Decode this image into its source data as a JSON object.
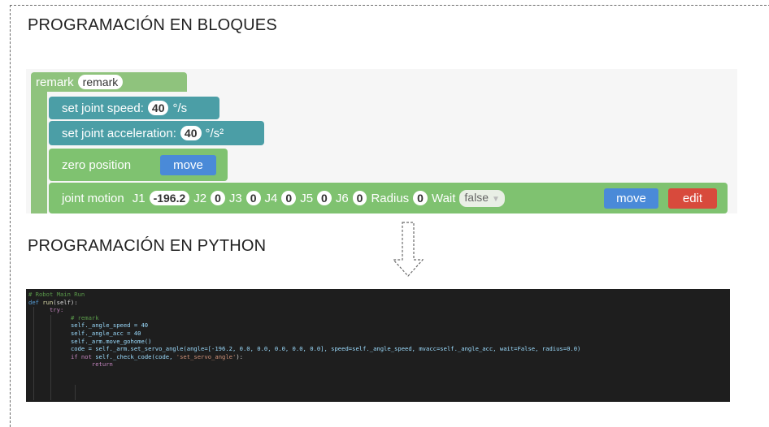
{
  "headings": {
    "blocks": "PROGRAMACIÓN EN BLOQUES",
    "python": "PROGRAMACIÓN EN PYTHON"
  },
  "blocks": {
    "remark": {
      "label": "remark",
      "value": "remark"
    },
    "speed": {
      "label": "set joint speed:",
      "value": "40",
      "unit": "°/s"
    },
    "acc": {
      "label": "set joint acceleration:",
      "value": "40",
      "unit": "°/s²"
    },
    "zero": {
      "label": "zero position",
      "action": "move"
    },
    "joint": {
      "label": "joint motion",
      "j1_label": "J1",
      "j1": "-196.2",
      "j2_label": "J2",
      "j2": "0",
      "j3_label": "J3",
      "j3": "0",
      "j4_label": "J4",
      "j4": "0",
      "j5_label": "J5",
      "j5": "0",
      "j6_label": "J6",
      "j6": "0",
      "radius_label": "Radius",
      "radius": "0",
      "wait_label": "Wait",
      "wait": "false",
      "action": "move",
      "edit": "edit"
    }
  },
  "code": {
    "l1": "# Robot Main Run",
    "l2_kw": "def",
    "l2_fn": "run",
    "l2_rest": "(self):",
    "l3": "try:",
    "l4": "# remark",
    "l5": "self._angle_speed = 40",
    "l6": "self._angle_acc = 40",
    "l7": "self._arm.move_gohome()",
    "l8": "code = self._arm.set_servo_angle(angle=[-196.2, 0.0, 0.0, 0.0, 0.0, 0.0], speed=self._angle_speed, mvacc=self._angle_acc, wait=False, radius=0.0)",
    "l9_kw": "if not",
    "l9_rest": " self._check_code(code, ",
    "l9_str": "'set_servo_angle'",
    "l9_end": "):",
    "l10": "return"
  },
  "colors": {
    "remark_block": "#8fc37d",
    "teal_block": "#4b9ea6",
    "green_block": "#7fc270",
    "move_button": "#4a8ad8",
    "edit_button": "#d84a3c",
    "code_bg": "#1e1e1e"
  },
  "icons": {
    "arrow": "dashed-down-arrow-icon"
  }
}
